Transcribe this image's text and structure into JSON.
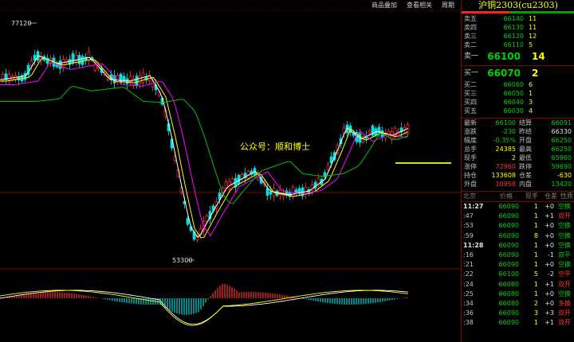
{
  "toolbar": {
    "overlay": "商品叠加",
    "view_related": "查看相关",
    "period": "周期"
  },
  "chart": {
    "high_label": "77120",
    "low_label": "53300",
    "watermark": "公众号：顺和博士",
    "colors": {
      "up": "#ff3030",
      "down": "#00e0e0",
      "ma5": "#ffffff",
      "ma10": "#ffff00",
      "ma20": "#ff00ff",
      "ma60": "#00c000",
      "border": "#800000"
    }
  },
  "panel": {
    "title": "沪铜2303(cu2303)",
    "asks": [
      {
        "label": "卖五",
        "price": "66140",
        "vol": "11"
      },
      {
        "label": "卖四",
        "price": "66130",
        "vol": "11"
      },
      {
        "label": "卖三",
        "price": "66120",
        "vol": "12"
      },
      {
        "label": "卖二",
        "price": "66110",
        "vol": "5"
      }
    ],
    "ask1": {
      "label": "卖一",
      "price": "66100",
      "vol": "14"
    },
    "bid1": {
      "label": "买一",
      "price": "66070",
      "vol": "2"
    },
    "bids": [
      {
        "label": "买二",
        "price": "66060",
        "vol": "6"
      },
      {
        "label": "买三",
        "price": "66050",
        "vol": "1"
      },
      {
        "label": "买四",
        "price": "66040",
        "vol": "3"
      },
      {
        "label": "买五",
        "price": "66030",
        "vol": "4"
      }
    ],
    "stats": [
      {
        "a": "最新",
        "av": "66100",
        "ac": "g",
        "b": "结算",
        "bv": "66091",
        "bc": "g"
      },
      {
        "a": "涨跌",
        "av": "-230",
        "ac": "g",
        "b": "昨结",
        "bv": "66330",
        "bc": "w"
      },
      {
        "a": "幅度",
        "av": "-0.35%",
        "ac": "g",
        "b": "开盘",
        "bv": "66250",
        "bc": "g"
      },
      {
        "a": "总手",
        "av": "24385",
        "ac": "y",
        "b": "最高",
        "bv": "66250",
        "bc": "g"
      },
      {
        "a": "现手",
        "av": "2",
        "ac": "y",
        "b": "最低",
        "bv": "65960",
        "bc": "g"
      },
      {
        "a": "涨停",
        "av": "72960",
        "ac": "r",
        "b": "跌停",
        "bv": "59690",
        "bc": "g"
      },
      {
        "a": "持仓",
        "av": "133608",
        "ac": "y",
        "b": "仓差",
        "bv": "-630",
        "bc": "y"
      },
      {
        "a": "外盘",
        "av": "10958",
        "ac": "r",
        "b": "内盘",
        "bv": "13420",
        "bc": "g"
      }
    ],
    "tick_head": {
      "region": "北京",
      "price": "价格",
      "vol": "现手",
      "oi": "仓差",
      "nature": "性质"
    },
    "ticks": [
      {
        "t": "11:27",
        "big": true,
        "p": "66090",
        "pc": "g",
        "v": "1",
        "o": "+0",
        "n": "空换",
        "nc": "g"
      },
      {
        "t": ":47",
        "big": false,
        "p": "66090",
        "pc": "g",
        "v": "1",
        "o": "+1",
        "n": "双开",
        "nc": "r"
      },
      {
        "t": ":53",
        "big": false,
        "p": "66090",
        "pc": "g",
        "v": "1",
        "o": "+0",
        "n": "空换",
        "nc": "g"
      },
      {
        "t": ":59",
        "big": false,
        "p": "66090",
        "pc": "g",
        "v": "8",
        "o": "+0",
        "n": "空换",
        "nc": "g"
      },
      {
        "t": "11:28",
        "big": true,
        "p": "66090",
        "pc": "g",
        "v": "1",
        "o": "+0",
        "n": "空换",
        "nc": "g"
      },
      {
        "t": ":16",
        "big": false,
        "p": "66090",
        "pc": "g",
        "v": "1",
        "o": "-1",
        "n": "双平",
        "nc": "g"
      },
      {
        "t": ":21",
        "big": false,
        "p": "66090",
        "pc": "g",
        "v": "1",
        "o": "+0",
        "n": "空换",
        "nc": "g"
      },
      {
        "t": ":22",
        "big": false,
        "p": "66100",
        "pc": "g",
        "v": "5",
        "o": "-2",
        "n": "空平",
        "nc": "r"
      },
      {
        "t": ":24",
        "big": false,
        "p": "66080",
        "pc": "g",
        "v": "1",
        "o": "+1",
        "n": "双开",
        "nc": "r"
      },
      {
        "t": ":25",
        "big": false,
        "p": "66080",
        "pc": "g",
        "v": "1",
        "o": "+0",
        "n": "空换",
        "nc": "g"
      },
      {
        "t": ":34",
        "big": false,
        "p": "66080",
        "pc": "g",
        "v": "2",
        "o": "+0",
        "n": "多换",
        "nc": "r"
      },
      {
        "t": ":36",
        "big": false,
        "p": "66090",
        "pc": "g",
        "v": "3",
        "o": "+3",
        "n": "双开",
        "nc": "r"
      },
      {
        "t": ":38",
        "big": false,
        "p": "66090",
        "pc": "g",
        "v": "1",
        "o": "+1",
        "n": "双开",
        "nc": "r"
      }
    ]
  }
}
